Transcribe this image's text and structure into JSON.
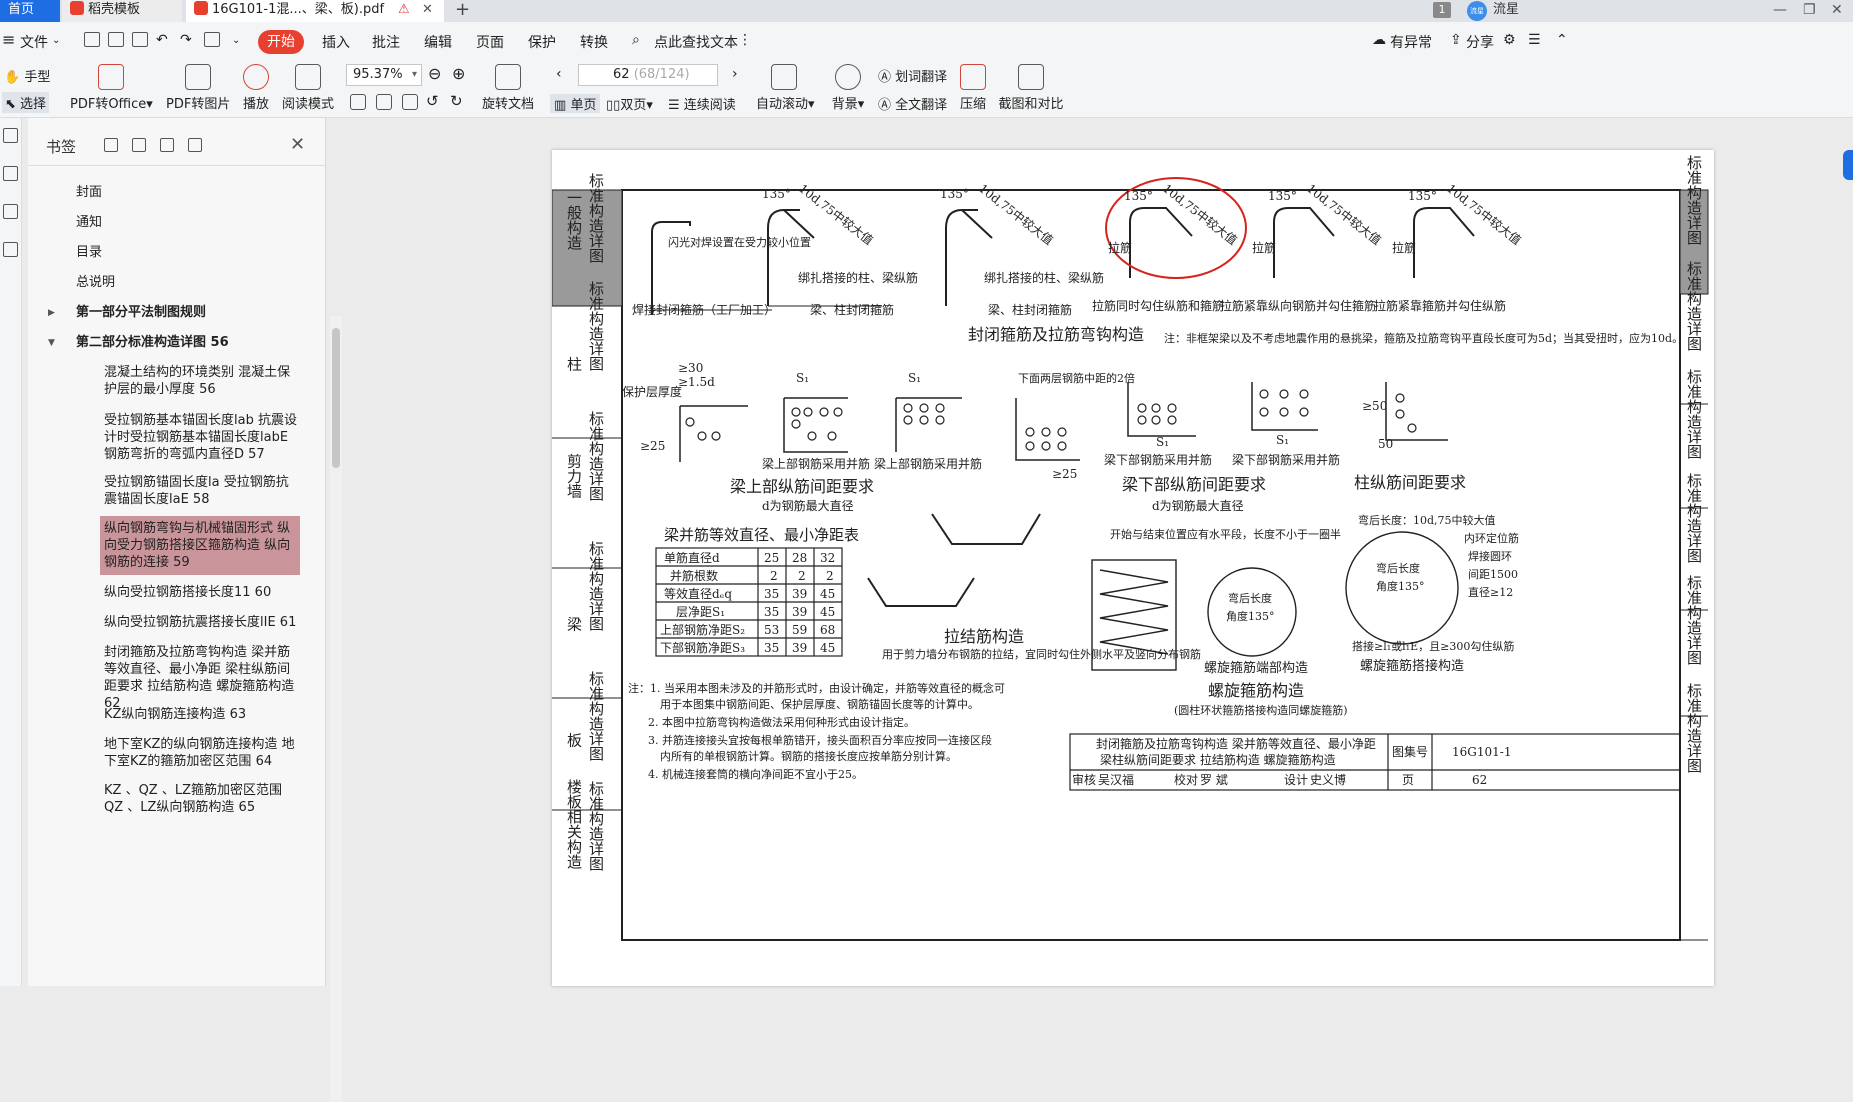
{
  "tabs": {
    "home": "首页",
    "template": "稻壳模板",
    "document": "16G101-1混...、梁、板).pdf",
    "add": "+"
  },
  "titlebar": {
    "badge": "1",
    "avatar_text": "流星",
    "user_name": "流星",
    "min": "—",
    "max": "❐",
    "close": "✕"
  },
  "menu": {
    "file": "文件",
    "start": "开始",
    "insert": "插入",
    "annotate": "批注",
    "edit": "编辑",
    "page": "页面",
    "protect": "保护",
    "convert": "转换",
    "search": "点此查找文本",
    "abnormal": "有异常",
    "share": "分享"
  },
  "ribbon": {
    "hand": "手型",
    "select": "选择",
    "pdf_to_office": "PDF转Office",
    "pdf_to_image": "PDF转图片",
    "play": "播放",
    "read_mode": "阅读模式",
    "zoom": "95.37%",
    "rotate": "旋转文档",
    "page_current": "62",
    "page_total": "(68/124)",
    "single": "单页",
    "double": "双页",
    "continuous": "连续阅读",
    "auto_scroll": "自动滚动",
    "background": "背景",
    "word_translate": "划词翻译",
    "full_translate": "全文翻译",
    "compress": "压缩",
    "screenshot_compare": "截图和对比"
  },
  "bookmarks": {
    "title": "书签",
    "items": [
      {
        "label": "封面"
      },
      {
        "label": "通知"
      },
      {
        "label": "目录"
      },
      {
        "label": "总说明"
      },
      {
        "label": "第一部分平法制图规则"
      },
      {
        "label": "第二部分标准构造详图 56"
      },
      {
        "label": "混凝土结构的环境类别 混凝土保护层的最小厚度 56"
      },
      {
        "label": "受拉钢筋基本锚固长度lab 抗震设计时受拉钢筋基本锚固长度labE 钢筋弯折的弯弧内直径D 57"
      },
      {
        "label": "受拉钢筋锚固长度la 受拉钢筋抗震锚固长度laE 58"
      },
      {
        "label": "纵向钢筋弯钩与机械锚固形式 纵向受力钢筋搭接区箍筋构造 纵向钢筋的连接 59"
      },
      {
        "label": "纵向受拉钢筋搭接长度11 60"
      },
      {
        "label": "纵向受拉钢筋抗震搭接长度lIE 61"
      },
      {
        "label": "封闭箍筋及拉筋弯钩构造 梁并筋等效直径、最小净距 梁柱纵筋间距要求 拉结筋构造 螺旋箍筋构造 62"
      },
      {
        "label": "KZ纵向钢筋连接构造 63"
      },
      {
        "label": "地下室KZ的纵向钢筋连接构造 地下室KZ的箍筋加密区范围 64"
      },
      {
        "label": "KZ 、QZ 、LZ箍筋加密区范围 QZ 、LZ纵向钢筋构造 65"
      }
    ]
  },
  "drawing": {
    "side_left": [
      "一般构造",
      "柱",
      "剪力墙",
      "梁",
      "板",
      "楼板相关构造"
    ],
    "side_std": "标准构造详图",
    "side_right": [
      "标准构造详图",
      "标准构造详图",
      "标准构造详图",
      "标准构造详图",
      "标准构造详图",
      "标准构造详图"
    ],
    "titles": {
      "closed_stirrup": "封闭箍筋及拉筋弯钩构造",
      "beam_top": "梁上部纵筋间距要求",
      "beam_bottom": "梁下部纵筋间距要求",
      "column": "柱纵筋间距要求",
      "tie_bar": "拉结筋构造",
      "spiral": "螺旋箍筋构造",
      "bundle_table": "梁并筋等效直径、最小净距表"
    },
    "labels": {
      "angle135": "135°",
      "hook": "10d,75中较大值",
      "flash_weld": "闪光对焊设置在受力较小位置",
      "weld_closed": "焊接封闭箍筋（工厂加工）",
      "beam_col_closed": "梁、柱封闭箍筋",
      "bind_lap": "绑扎搭接的柱、梁纵筋",
      "tie": "拉筋",
      "tie_both": "拉筋同时勾住纵筋和箍筋",
      "tie_long": "拉筋紧靠纵向钢筋并勾住箍筋",
      "tie_stirrup": "拉筋紧靠箍筋并勾住纵筋",
      "note_hook": "注：非框架梁以及不考虑地震作用的悬挑梁，箍筋及拉筋弯钩平直段长度可为5d；当其受扭时，应为10d。",
      "cover": "保护层厚度",
      "ge30": "≥30",
      "ge15d": "≥1.5d",
      "ge25": "≥25",
      "ge50": "≥50",
      "fifty": "50",
      "bundle_up": "梁上部钢筋采用并筋",
      "bundle_down": "梁下部钢筋采用并筋",
      "two_layer": "下面两层钢筋中距的2倍",
      "d_max": "d为钢筋最大直径",
      "s1": "S₁",
      "d": "d",
      "tie_wall": "用于剪力墙分布钢筋的拉结，宜同时勾住外侧水平及竖向分布钢筋",
      "spiral_start": "开始与结束位置应有水平段，长度不小于一圈半",
      "spiral_end": "螺旋箍筋端部构造",
      "spiral_lap": "螺旋箍筋搭接构造",
      "bend_len": "弯后长度：10d,75中较大值",
      "inner_pos": "内环定位筋",
      "weld_ring": "焊接圆环",
      "spacing": "间距1500",
      "dia12": "直径≥12",
      "bend_after": "弯后长度",
      "angle_135": "角度135°",
      "lap_rule": "搭接≥l₁或l₁E，且≥300勾住纵筋",
      "circle_note": "(圆柱环状箍筋搭接构造同螺旋箍筋)"
    },
    "table": {
      "rows": [
        {
          "name": "单筋直径d",
          "v": [
            "25",
            "28",
            "32"
          ]
        },
        {
          "name": "并筋根数",
          "v": [
            "2",
            "2",
            "2"
          ]
        },
        {
          "name": "等效直径dₑq",
          "v": [
            "35",
            "39",
            "45"
          ]
        },
        {
          "name": "层净距S₁",
          "v": [
            "35",
            "39",
            "45"
          ]
        },
        {
          "name": "上部钢筋净距S₂",
          "v": [
            "53",
            "59",
            "68"
          ]
        },
        {
          "name": "下部钢筋净距S₃",
          "v": [
            "35",
            "39",
            "45"
          ]
        }
      ]
    },
    "notes": [
      "注：1. 当采用本图未涉及的并筋形式时，由设计确定，并筋等效直径的概念可",
      "用于本图集中钢筋间距、保护层厚度、钢筋锚固长度等的计算中。",
      "2. 本图中拉筋弯钩构造做法采用何种形式由设计指定。",
      "3. 并筋连接接头宜按每根单筋错开，接头面积百分率应按同一连接区段",
      "内所有的单根钢筋计算。钢筋的搭接长度应按单筋分别计算。",
      "4. 机械连接套筒的横向净间距不宜小于25。"
    ],
    "titleblock": {
      "line1": "封闭箍筋及拉筋弯钩构造  梁并筋等效直径、最小净距",
      "line2": "梁柱纵筋间距要求   拉结筋构造   螺旋箍筋构造",
      "atlas_label": "图集号",
      "atlas_no": "16G101-1",
      "page_label": "页",
      "page_no": "62",
      "review": "审核",
      "reviewer": "吴汉福",
      "check": "校对",
      "checker": "罗 斌",
      "design": "设计",
      "designer": "史义博"
    }
  }
}
